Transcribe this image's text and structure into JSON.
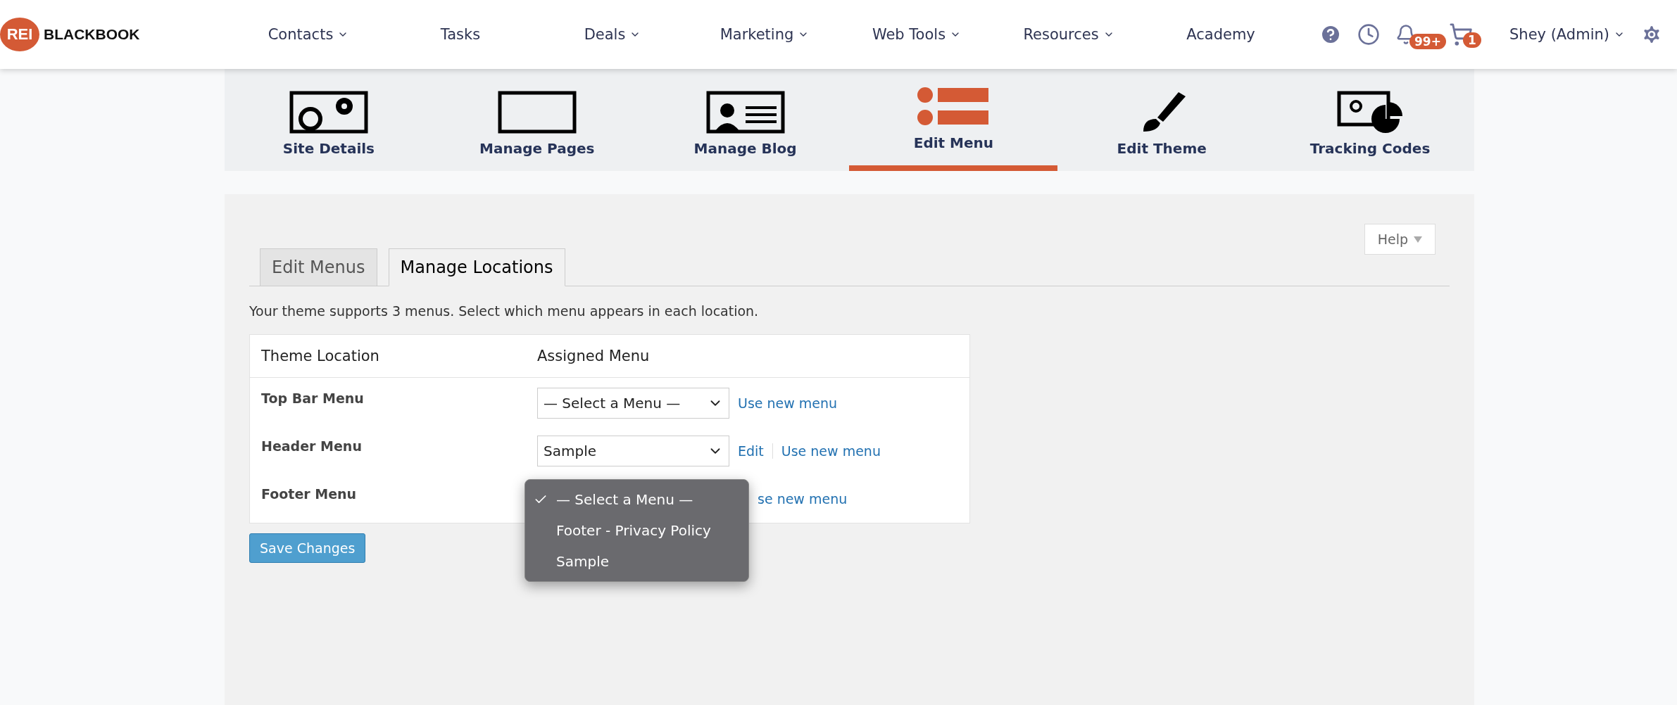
{
  "brand": {
    "badge": "REI",
    "name": "BLACKBOOK"
  },
  "nav": [
    {
      "label": "Contacts",
      "dropdown": true
    },
    {
      "label": "Tasks",
      "dropdown": false
    },
    {
      "label": "Deals",
      "dropdown": true
    },
    {
      "label": "Marketing",
      "dropdown": true
    },
    {
      "label": "Web Tools",
      "dropdown": true
    },
    {
      "label": "Resources",
      "dropdown": true
    },
    {
      "label": "Academy",
      "dropdown": false
    }
  ],
  "badges": {
    "notifications": "99+",
    "cart": "1"
  },
  "user": {
    "name": "Shey (Admin)"
  },
  "tools": [
    {
      "label": "Site Details",
      "kind": "site",
      "selected": false
    },
    {
      "label": "Manage Pages",
      "kind": "pages",
      "selected": false
    },
    {
      "label": "Manage Blog",
      "kind": "blog",
      "selected": false
    },
    {
      "label": "Edit Menu",
      "kind": "menu",
      "selected": true
    },
    {
      "label": "Edit Theme",
      "kind": "theme",
      "selected": false
    },
    {
      "label": "Tracking Codes",
      "kind": "tracking",
      "selected": false
    }
  ],
  "help": "Help",
  "tabs": [
    {
      "label": "Edit Menus",
      "selected": false
    },
    {
      "label": "Manage Locations",
      "selected": true
    }
  ],
  "description": "Your theme supports 3 menus. Select which menu appears in each location.",
  "table": {
    "columns": [
      "Theme Location",
      "Assigned Menu"
    ],
    "rows": [
      {
        "location": "Top Bar Menu",
        "value": "— Select a Menu —",
        "links": [
          "Use new menu"
        ]
      },
      {
        "location": "Header Menu",
        "value": "Sample",
        "links": [
          "Edit",
          "Use new menu"
        ]
      },
      {
        "location": "Footer Menu",
        "options": [
          {
            "label": "— Select a Menu —",
            "selected": true
          },
          {
            "label": "Footer - Privacy Policy",
            "selected": false
          },
          {
            "label": "Sample",
            "selected": false
          }
        ],
        "links": [
          "se new menu"
        ]
      }
    ]
  },
  "save": "Save Changes"
}
